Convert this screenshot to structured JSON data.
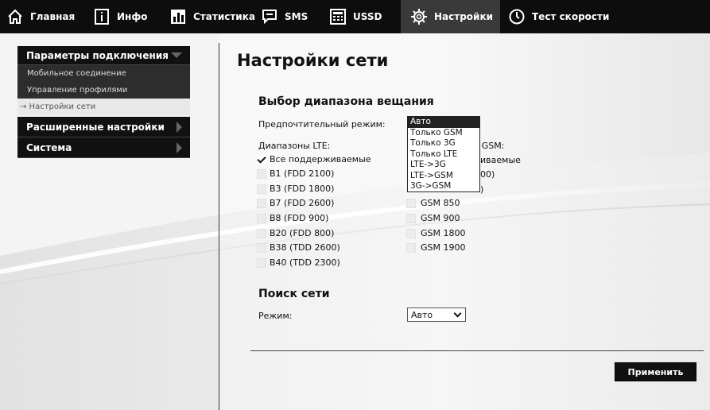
{
  "nav": {
    "home": "Главная",
    "info": "Инфо",
    "stats": "Статистика",
    "sms": "SMS",
    "ussd": "USSD",
    "settings": "Настройки",
    "speedtest": "Тест скорости"
  },
  "sidebar": {
    "connection": "Параметры подключения",
    "mobile": "Мобильное соединение",
    "profiles": "Управление профилями",
    "network": "→ Настройки сети",
    "advanced": "Расширенные настройки",
    "system": "Система"
  },
  "main": {
    "title": "Настройки сети",
    "band_title": "Выбор диапазона вещания",
    "preferred_label": "Предпочтительный режим:",
    "lte_label": "Диапазоны LTE:",
    "gsm_label": "Диапазоны GSM:",
    "gsm_label_visible": "н GSM:",
    "lte_bands": [
      {
        "label": "Все поддерживаемые",
        "checked": true
      },
      {
        "label": "B1 (FDD 2100)",
        "checked": false
      },
      {
        "label": "B3 (FDD 1800)",
        "checked": false
      },
      {
        "label": "B7 (FDD 2600)",
        "checked": false
      },
      {
        "label": "B8 (FDD 900)",
        "checked": false
      },
      {
        "label": "B20 (FDD 800)",
        "checked": false
      },
      {
        "label": "B38 (TDD 2600)",
        "checked": false
      },
      {
        "label": "B40 (TDD 2300)",
        "checked": false
      }
    ],
    "gsm_bands_partial": [
      "иваемые",
      "00)",
      ")"
    ],
    "gsm_bands": [
      "GSM 850",
      "GSM 900",
      "GSM 1800",
      "GSM 1900"
    ],
    "mode_options": [
      "Авто",
      "Только GSM",
      "Только 3G",
      "Только LTE",
      "LTE->3G",
      "LTE->GSM",
      "3G->GSM"
    ],
    "search_title": "Поиск сети",
    "search_mode_label": "Режим:",
    "search_mode_value": "Авто",
    "apply": "Применить"
  }
}
